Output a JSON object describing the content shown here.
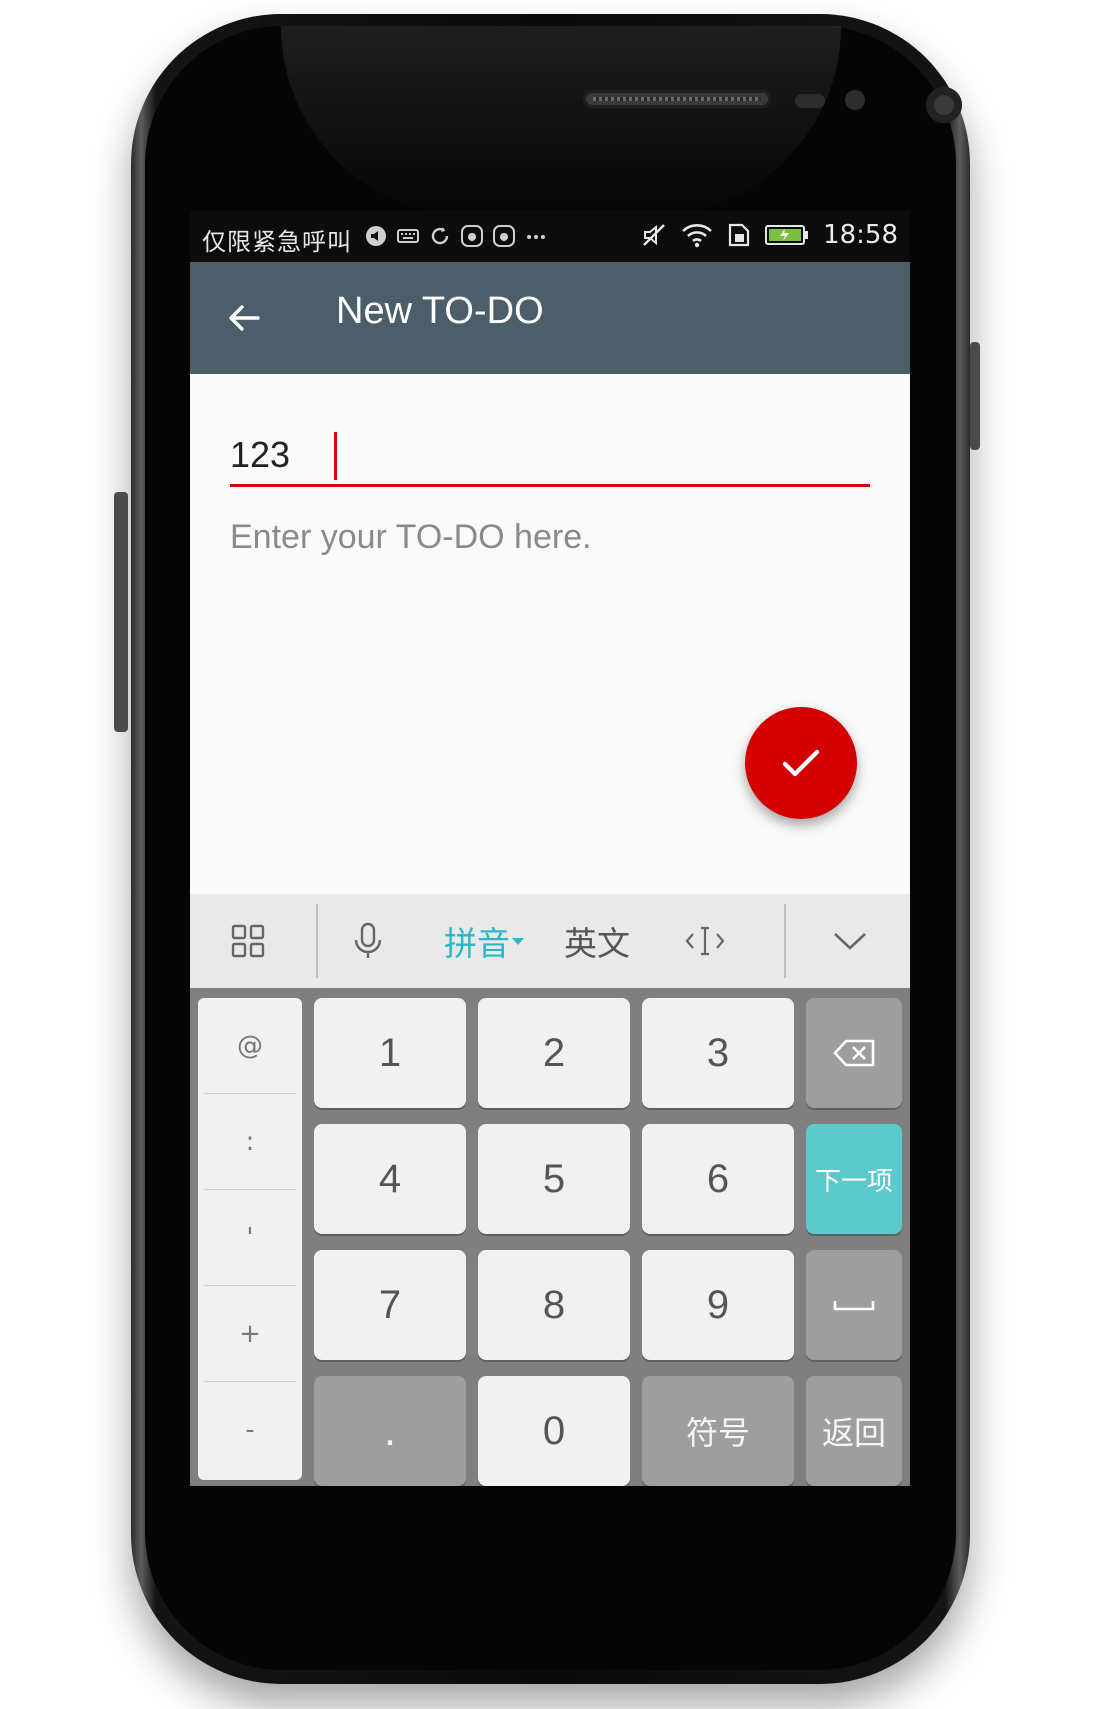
{
  "status_bar": {
    "carrier_text": "仅限紧急呼叫",
    "time": "18:58",
    "icons": [
      "volume-icon",
      "keyboard-icon",
      "sync-icon",
      "huawei-icon",
      "huawei-icon",
      "more-dots-icon",
      "mute-icon",
      "wifi-icon",
      "sim-icon",
      "battery-icon"
    ]
  },
  "app_bar": {
    "title": "New TO-DO",
    "back_icon": "arrow-left-icon",
    "color": "#4b5e69"
  },
  "form": {
    "title_value": "123",
    "body_placeholder": "Enter your TO-DO here.",
    "accent_color": "#d40000"
  },
  "fab": {
    "icon": "check-icon",
    "color": "#d50000"
  },
  "keyboard": {
    "toolbar": {
      "grid_icon": "grid-icon",
      "mic_icon": "microphone-icon",
      "pinyin_label": "拼音",
      "english_label": "英文",
      "cursor_icon": "cursor-move-icon",
      "collapse_icon": "chevron-down-icon"
    },
    "symbols": [
      "@",
      ":",
      "'",
      "+",
      "-"
    ],
    "digits": [
      "1",
      "2",
      "3",
      "4",
      "5",
      "6",
      "7",
      "8",
      "9",
      "0"
    ],
    "dot_label": ".",
    "backspace_icon": "backspace-icon",
    "next_label": "下一项",
    "space_icon": "space-icon",
    "symbols_label": "符号",
    "return_label": "返回",
    "accent_color": "#5cc9cc"
  }
}
